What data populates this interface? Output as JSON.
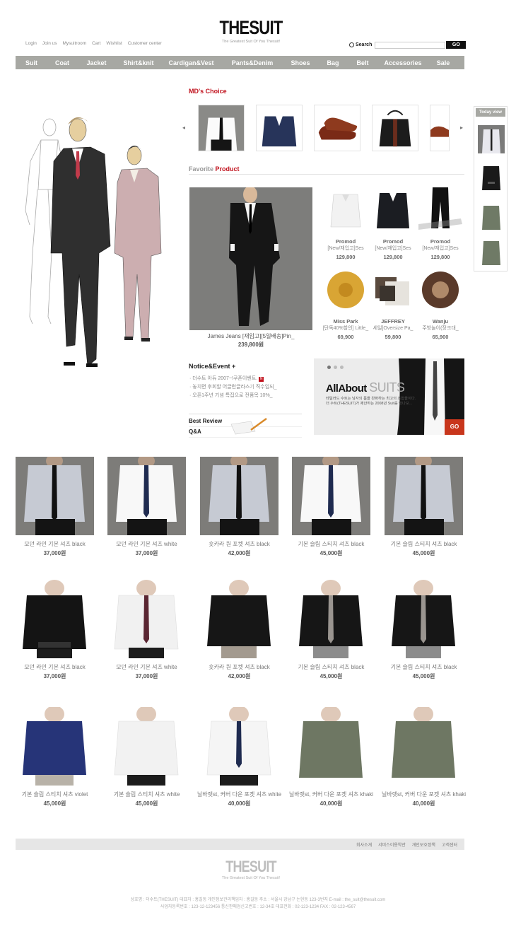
{
  "header": {
    "logo": "THESUIT",
    "tagline": "The Greatest Suit Of You Thesuit!",
    "top_links": [
      "Login",
      "Join us",
      "Mysuitroom",
      "Cart",
      "Wishlist",
      "Customer center"
    ],
    "search_label": "Search",
    "search_button": "GO"
  },
  "nav": [
    "Suit",
    "Coat",
    "Jacket",
    "Shirt&knit",
    "Cardigan&Vest",
    "Pants&Denim",
    "Shoes",
    "Bag",
    "Belt",
    "Accessories",
    "Sale"
  ],
  "md_choice": {
    "title": "MD's Choice"
  },
  "favorite": {
    "title_a": "Favorite",
    "title_b": "Product",
    "main": {
      "name": "James Jeans [재입고][5일배송]Pin_",
      "price": "239,800원"
    },
    "items": [
      {
        "name": "Promod",
        "desc": "[New/재입고]Ses",
        "price": "129,800"
      },
      {
        "name": "Promod",
        "desc": "[New/재입고]Ses",
        "price": "129,800"
      },
      {
        "name": "Promod",
        "desc": "[New/재입고]Ses",
        "price": "129,800"
      },
      {
        "name": "Miss Park",
        "desc": "[단독40%할인] Little_",
        "price": "69,900"
      },
      {
        "name": "JEFFREY",
        "desc": "세일]Oversize Pa_",
        "price": "59,800"
      },
      {
        "name": "Wanju",
        "desc": "주방놀이(장크대_",
        "price": "65,900"
      }
    ]
  },
  "notice": {
    "title": "Notice&Event",
    "plus": "+",
    "items": [
      "· 더수트 아듀 2007~!쿠폰이벤트.",
      "· 놓치면 후회할 어글런글라스기 직수입되_",
      "· 오픈1주년 기념 특집으로 전품목 10%_"
    ],
    "new_badge": "N",
    "best_review": "Best Review",
    "qa": "Q&A"
  },
  "banner": {
    "headline_a": "AllAbout",
    "headline_b": "SUITS",
    "sub": "테일러드 수트는 남자의 품을 완화하는 최고의 조합을이다. 더 수트(THESUIT)가 제안하는 2008년 Suit를 만나보...",
    "go": "GO"
  },
  "today_view": {
    "title": "Today view"
  },
  "products": [
    {
      "name": "모던 라인 기본 셔츠 black",
      "price": "37,000원"
    },
    {
      "name": "모던 라인 기본 셔츠 white",
      "price": "37,000원"
    },
    {
      "name": "숏카라 원 포켓 셔츠 black",
      "price": "42,000원"
    },
    {
      "name": "기본 슬림 스티치 셔츠 black",
      "price": "45,000원"
    },
    {
      "name": "기본 슬림 스티치 셔츠 black",
      "price": "45,000원"
    },
    {
      "name": "모던 라인 기본 셔츠 black",
      "price": "37,000원"
    },
    {
      "name": "모던 라인 기본 셔츠 white",
      "price": "37,000원"
    },
    {
      "name": "숏카라 원 포켓 셔츠 black",
      "price": "42,000원"
    },
    {
      "name": "기본 슬림 스티치 셔츠 black",
      "price": "45,000원"
    },
    {
      "name": "기본 슬림 스티치 셔츠 black",
      "price": "45,000원"
    },
    {
      "name": "기본 슬림 스티치 셔츠 violet",
      "price": "45,000원"
    },
    {
      "name": "기본 슬림 스티치 셔츠 white",
      "price": "45,000원"
    },
    {
      "name": "닐바렛st, 커버 다운 포켓 셔츠 white",
      "price": "40,000원"
    },
    {
      "name": "닐바렛st, 커버 다운 포켓 셔츠 khaki",
      "price": "40,000원"
    },
    {
      "name": "닐바렛st, 커버 다운 포켓 셔츠 khaki",
      "price": "40,000원"
    }
  ],
  "footer": {
    "links": [
      "회사소개",
      "서비스이용약관",
      "개인보호정책",
      "고객센터"
    ],
    "logo": "THESUIT",
    "tagline": "The Greatest Suit Of You Thesuit!",
    "info_line1": "상호명 : 더수트(THESUIT) 대표자 : 홍길동 개인정보관리책임자 : 홍길동   주소 : 서울시 강남구 논현동 123-3번지  E-mail : the_suit@thesuit.com",
    "info_line2": "사업자등록번호 : 123-12-123456 통신판매업신고번호 : 12-34호 대표전화 : 02-123-1234  FAX : 02-123-4567"
  },
  "colors": {
    "accent": "#c1121d",
    "nav_bg": "#a7a8a3",
    "dark": "#111111"
  }
}
